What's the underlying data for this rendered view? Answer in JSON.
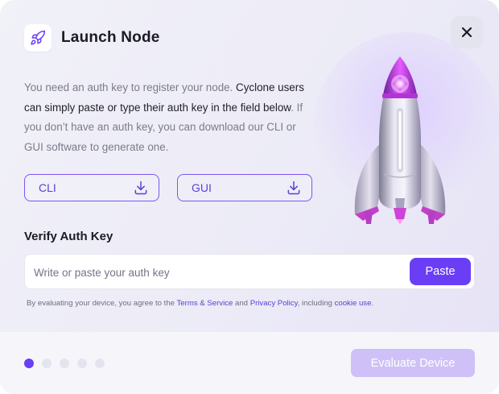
{
  "header": {
    "title": "Launch Node",
    "logo_icon": "rocket-icon",
    "close_icon": "close-icon"
  },
  "description": {
    "part1": "You need an auth key to register your node. ",
    "part2": "Cyclone users can simply paste or type their auth key in the field below",
    "part3": ". If you don’t have an auth key, you can download our CLI or GUI software to generate one."
  },
  "downloads": [
    {
      "label": "CLI",
      "icon": "download-icon"
    },
    {
      "label": "GUI",
      "icon": "download-icon"
    }
  ],
  "verify": {
    "label": "Verify Auth Key",
    "placeholder": "Write or paste your auth key",
    "value": "",
    "paste_label": "Paste"
  },
  "legal": {
    "prefix": "By evaluating your device, you agree to the ",
    "terms": "Terms & Service",
    "and": " and ",
    "privacy": "Privacy Policy",
    "including": ", including ",
    "cookie": "cookie use",
    "suffix": "."
  },
  "footer": {
    "steps_total": 5,
    "step_active": 1,
    "evaluate_label": "Evaluate Device"
  },
  "colors": {
    "accent": "#6a3ef5",
    "accent_disabled": "#cfc1f7",
    "outline": "#7b56f0"
  }
}
